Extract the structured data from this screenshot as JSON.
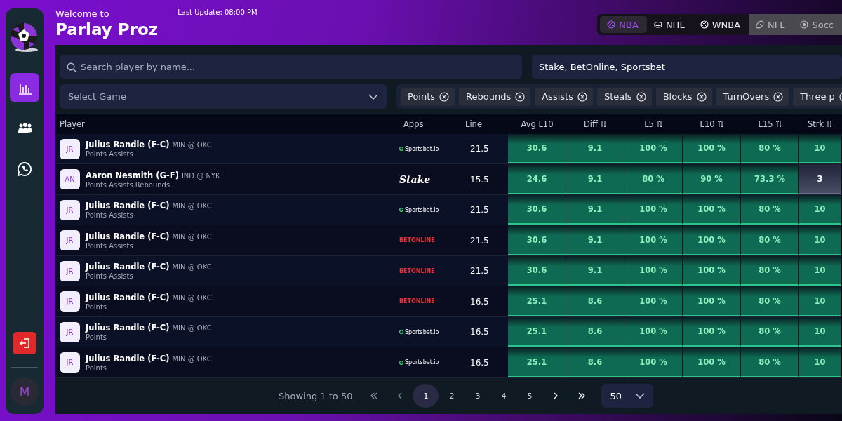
{
  "header": {
    "greeting": "Welcome to",
    "title": "Parlay Proz",
    "last_update": "Last Update: 08:00 PM"
  },
  "sidebar": {
    "items": [
      {
        "kind": "stats",
        "selected": true
      },
      {
        "kind": "groups",
        "selected": false
      },
      {
        "kind": "chat",
        "selected": false
      }
    ],
    "avatar": "M"
  },
  "sport_tabs": [
    {
      "label": "NBA",
      "kind": "basketball",
      "selected": true,
      "disabled": false
    },
    {
      "label": "NHL",
      "kind": "hockey",
      "selected": false,
      "disabled": false
    },
    {
      "label": "WNBA",
      "kind": "basketball",
      "selected": false,
      "disabled": false
    },
    {
      "label": "NFL",
      "kind": "football",
      "selected": false,
      "disabled": true
    },
    {
      "label": "Socc",
      "kind": "soccer",
      "selected": false,
      "disabled": true
    }
  ],
  "filters": {
    "search": {
      "placeholder": "Search player by name..."
    },
    "apps": {
      "value": "Stake, BetOnline, Sportsbet"
    },
    "game": {
      "placeholder": "Select Game"
    },
    "markets": [
      "Points",
      "Rebounds",
      "Assists",
      "Steals",
      "Blocks",
      "TurnOvers",
      "Three p"
    ]
  },
  "table": {
    "columns": [
      {
        "label": "Player",
        "sortable": false
      },
      {
        "label": "Apps",
        "sortable": false
      },
      {
        "label": "Line",
        "sortable": false
      },
      {
        "label": "Avg L10",
        "sortable": false
      },
      {
        "label": "Diff",
        "sortable": true
      },
      {
        "label": "L5",
        "sortable": true
      },
      {
        "label": "L10",
        "sortable": true
      },
      {
        "label": "L15",
        "sortable": true
      },
      {
        "label": "Strk",
        "sortable": true
      }
    ],
    "rows": [
      {
        "initials": "JR",
        "name": "Julius Randle (F-C)",
        "matchup": "MIN @ OKC",
        "markets": "Points Assists",
        "app": {
          "name": "Sportsbet.io",
          "kind": "sportsbet"
        },
        "line": "21.5",
        "stats": [
          {
            "value": "30.6",
            "hit": true
          },
          {
            "value": "9.1",
            "hit": true
          },
          {
            "value": "100 %",
            "hit": true
          },
          {
            "value": "100 %",
            "hit": true
          },
          {
            "value": "80 %",
            "hit": true
          },
          {
            "value": "10",
            "hit": true
          }
        ]
      },
      {
        "initials": "AN",
        "name": "Aaron Nesmith (G-F)",
        "matchup": "IND @ NYK",
        "markets": "Points Assists Rebounds",
        "app": {
          "name": "Stake",
          "kind": "stake"
        },
        "line": "15.5",
        "stats": [
          {
            "value": "24.6",
            "hit": true
          },
          {
            "value": "9.1",
            "hit": true
          },
          {
            "value": "80 %",
            "hit": true
          },
          {
            "value": "90 %",
            "hit": true
          },
          {
            "value": "73.3 %",
            "hit": true
          },
          {
            "value": "3",
            "hit": false
          }
        ]
      },
      {
        "initials": "JR",
        "name": "Julius Randle (F-C)",
        "matchup": "MIN @ OKC",
        "markets": "Points Assists",
        "app": {
          "name": "Sportsbet.io",
          "kind": "sportsbet"
        },
        "line": "21.5",
        "stats": [
          {
            "value": "30.6",
            "hit": true
          },
          {
            "value": "9.1",
            "hit": true
          },
          {
            "value": "100 %",
            "hit": true
          },
          {
            "value": "100 %",
            "hit": true
          },
          {
            "value": "80 %",
            "hit": true
          },
          {
            "value": "10",
            "hit": true
          }
        ]
      },
      {
        "initials": "JR",
        "name": "Julius Randle (F-C)",
        "matchup": "MIN @ OKC",
        "markets": "Points Assists",
        "app": {
          "name": "BETONLINE",
          "kind": "betonline"
        },
        "line": "21.5",
        "stats": [
          {
            "value": "30.6",
            "hit": true
          },
          {
            "value": "9.1",
            "hit": true
          },
          {
            "value": "100 %",
            "hit": true
          },
          {
            "value": "100 %",
            "hit": true
          },
          {
            "value": "80 %",
            "hit": true
          },
          {
            "value": "10",
            "hit": true
          }
        ]
      },
      {
        "initials": "JR",
        "name": "Julius Randle (F-C)",
        "matchup": "MIN @ OKC",
        "markets": "Points Assists",
        "app": {
          "name": "BETONLINE",
          "kind": "betonline"
        },
        "line": "21.5",
        "stats": [
          {
            "value": "30.6",
            "hit": true
          },
          {
            "value": "9.1",
            "hit": true
          },
          {
            "value": "100 %",
            "hit": true
          },
          {
            "value": "100 %",
            "hit": true
          },
          {
            "value": "80 %",
            "hit": true
          },
          {
            "value": "10",
            "hit": true
          }
        ]
      },
      {
        "initials": "JR",
        "name": "Julius Randle (F-C)",
        "matchup": "MIN @ OKC",
        "markets": "Points",
        "app": {
          "name": "BETONLINE",
          "kind": "betonline"
        },
        "line": "16.5",
        "stats": [
          {
            "value": "25.1",
            "hit": true
          },
          {
            "value": "8.6",
            "hit": true
          },
          {
            "value": "100 %",
            "hit": true
          },
          {
            "value": "100 %",
            "hit": true
          },
          {
            "value": "80 %",
            "hit": true
          },
          {
            "value": "10",
            "hit": true
          }
        ]
      },
      {
        "initials": "JR",
        "name": "Julius Randle (F-C)",
        "matchup": "MIN @ OKC",
        "markets": "Points",
        "app": {
          "name": "Sportsbet.io",
          "kind": "sportsbet"
        },
        "line": "16.5",
        "stats": [
          {
            "value": "25.1",
            "hit": true
          },
          {
            "value": "8.6",
            "hit": true
          },
          {
            "value": "100 %",
            "hit": true
          },
          {
            "value": "100 %",
            "hit": true
          },
          {
            "value": "80 %",
            "hit": true
          },
          {
            "value": "10",
            "hit": true
          }
        ]
      },
      {
        "initials": "JR",
        "name": "Julius Randle (F-C)",
        "matchup": "MIN @ OKC",
        "markets": "Points",
        "app": {
          "name": "Sportsbet.io",
          "kind": "sportsbet"
        },
        "line": "16.5",
        "stats": [
          {
            "value": "25.1",
            "hit": true
          },
          {
            "value": "8.6",
            "hit": true
          },
          {
            "value": "100 %",
            "hit": true
          },
          {
            "value": "100 %",
            "hit": true
          },
          {
            "value": "80 %",
            "hit": true
          },
          {
            "value": "10",
            "hit": true
          }
        ]
      }
    ]
  },
  "pagination": {
    "summary": "Showing 1 to 50",
    "pages": [
      {
        "label": "1",
        "selected": true
      },
      {
        "label": "2",
        "selected": false
      },
      {
        "label": "3",
        "selected": false
      },
      {
        "label": "4",
        "selected": false
      },
      {
        "label": "5",
        "selected": false
      }
    ],
    "page_size": "50"
  }
}
